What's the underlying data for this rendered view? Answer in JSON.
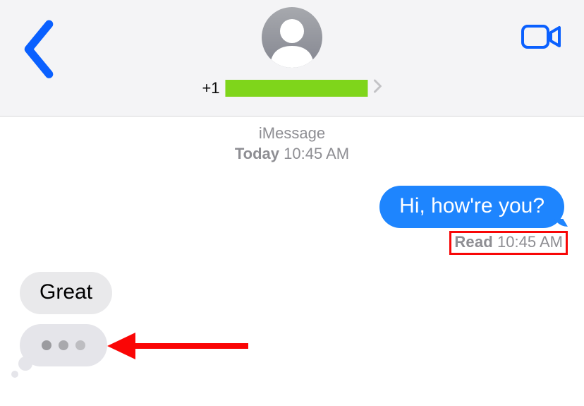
{
  "header": {
    "contact_prefix": "+1",
    "contact_redacted": true
  },
  "timestamp": {
    "service": "iMessage",
    "day": "Today",
    "time": "10:45 AM"
  },
  "messages": {
    "sent_text": "Hi, how're you?",
    "receipt_label": "Read",
    "receipt_time": "10:45 AM",
    "received_text": "Great"
  },
  "annotations": {
    "receipt_highlight_color": "#f80707",
    "arrow_color": "#fa0606"
  }
}
